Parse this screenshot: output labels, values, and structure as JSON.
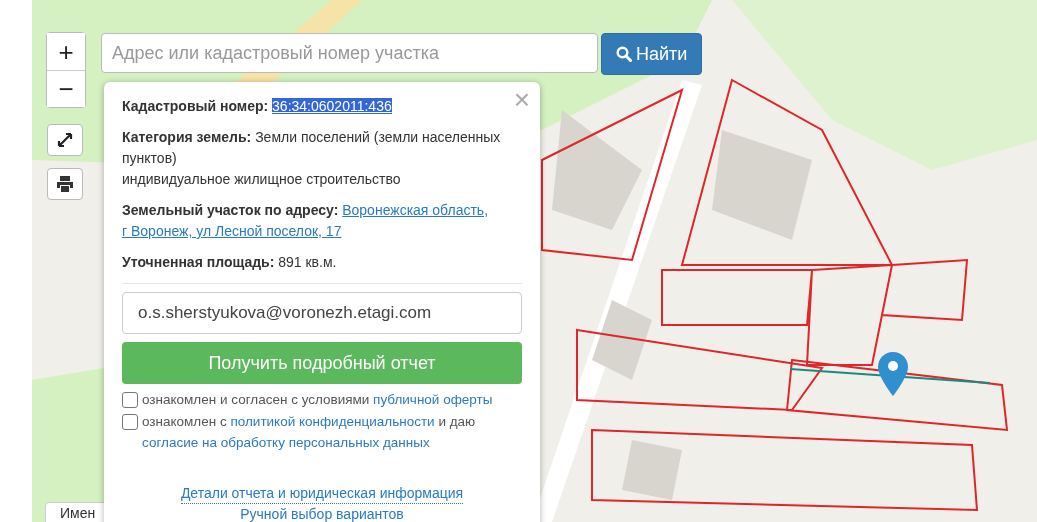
{
  "zoom": {
    "in": "+",
    "out": "−"
  },
  "search": {
    "placeholder": "Адрес или кадастровый номер участка",
    "button": "Найти"
  },
  "bottom_tab": "Имен",
  "popup": {
    "close": "×",
    "cadastral": {
      "label": "Кадастровый номер:",
      "value": "36:34:0602011:436",
      "highlighted": true
    },
    "category": {
      "text": "**Категория земель:** Земли поселений (земли населенных пунктов)",
      "note": "индивидуальное жилищное строительство"
    },
    "address": {
      "label": "Земельный участок по адресу:",
      "link_lines": [
        "Воронежская область,",
        "г Воронеж, ул Лесной поселок, 17"
      ]
    },
    "area": {
      "text": "**Уточненная площадь:** 891 кв.м."
    },
    "email": {
      "value": "o.s.sherstyukova@voronezh.etagi.com"
    },
    "submit": "Получить подробный отчет",
    "consents": [
      {
        "checked": false,
        "parts": [
          {
            "kind": "text",
            "text": "ознакомлен и согласен с условиями "
          },
          {
            "kind": "link",
            "text": "публичной оферты"
          }
        ]
      },
      {
        "checked": false,
        "parts": [
          {
            "kind": "text",
            "text": "ознакомлен с "
          },
          {
            "kind": "link",
            "text": "политикой конфиденциальности"
          },
          {
            "kind": "text",
            "text": " и даю "
          },
          {
            "kind": "link",
            "text": "согласие на обработку персональных данных"
          }
        ]
      }
    ],
    "links": [
      "Детали отчета и юридическая информация",
      "Ручной выбор вариантов"
    ]
  }
}
